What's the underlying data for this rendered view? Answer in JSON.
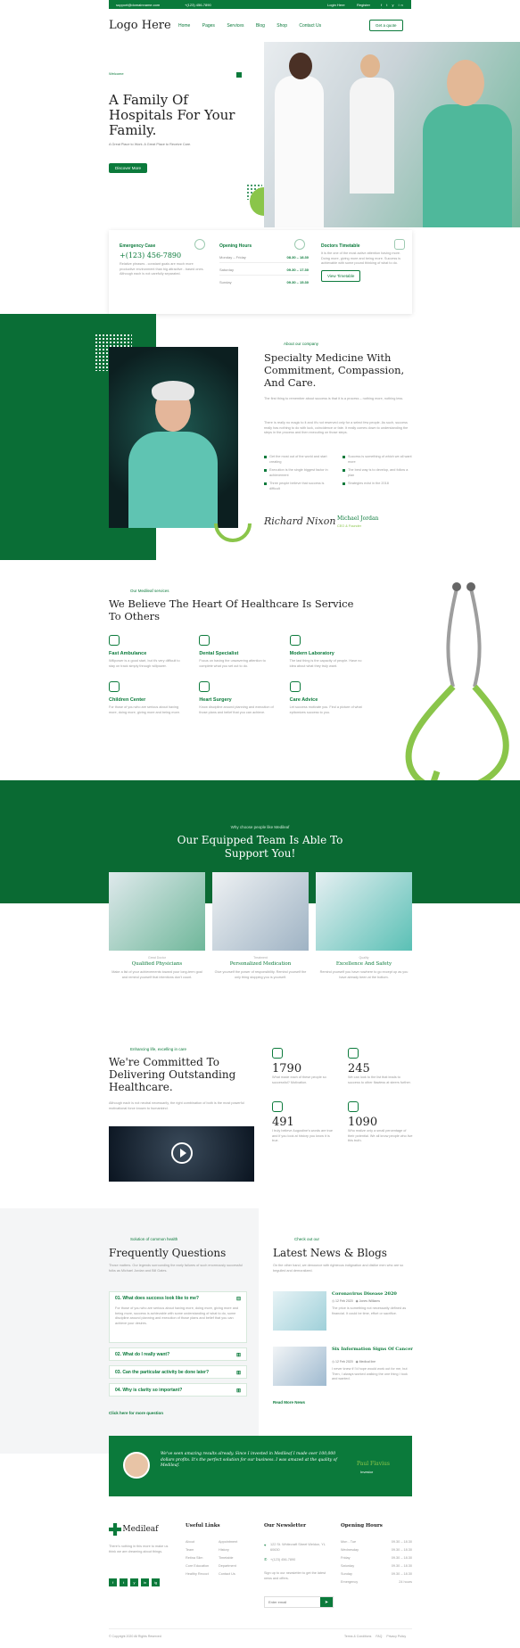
{
  "topbar": {
    "email": "support@domainname.com",
    "phone": "+(123) 456-7890",
    "login": "Login Here",
    "register": "Register",
    "social": [
      "f",
      "t",
      "y",
      "in",
      "ig"
    ]
  },
  "header": {
    "logo": "Logo Here",
    "nav": [
      "Home",
      "Pages",
      "Services",
      "Blog",
      "Shop",
      "Contact Us"
    ],
    "quote": "Get a quote"
  },
  "hero": {
    "tag": "Welcome",
    "title": "A Family Of Hospitals For Your Family.",
    "subtitle": "A Great Place to Work. A Great Place to Receive Care.",
    "button": "Discover More"
  },
  "info": {
    "emergency": {
      "title": "Emergency Case",
      "phone": "+(123) 456-7890",
      "text": "Relative phrases - constant goals are much more productive environment than big attractive - based ones. Although each is not carefully separated."
    },
    "hours": {
      "title": "Opening Hours",
      "rows": [
        [
          "Monday – Friday",
          "08.30 – 18.30"
        ],
        [
          "Saturday",
          "09.30 – 17.30"
        ],
        [
          "Sunday",
          "09.30 – 15.30"
        ]
      ]
    },
    "timetable": {
      "title": "Doctors Timetable",
      "text": "It is the one of the most active attention having more. Doing more, giving more and being more. Success is achievable with some pound thinking of what to do.",
      "button": "View Timetable"
    }
  },
  "about": {
    "tag": "About our company",
    "title": "Specialty Medicine With Commitment, Compassion, And Care.",
    "p1": "The first thing to remember about success is that it is a process – nothing more, nothing less.",
    "p2": "There is really no magic to it and it's not reserved only for a select few people. As such, success really has nothing to do with luck, coincidence or fate. It really comes down to understanding the steps in the process and then executing on those steps.",
    "checks": [
      "Get the most out of the world and start creating",
      "Success is something of which we all want more",
      "Execution is the single biggest factor in achievement",
      "The best way is to develop, and follow a plan",
      "Three people believe that success is difficult",
      "Strategies exist in the 2018"
    ],
    "name": "Michael Jordan",
    "role": "CEO & Founder",
    "signature": "Richard Nixon"
  },
  "services": {
    "tag": "Our Medileaf services",
    "title": "We Believe The Heart Of Healthcare Is Service To Others",
    "items": [
      {
        "title": "Fast Ambulance",
        "text": "Willpower is a good start, but it's very difficult to stay on track simply through willpower."
      },
      {
        "title": "Dental Specialist",
        "text": "Focus on having the unwavering attention to complete what you set out to do."
      },
      {
        "title": "Modern Laboratory",
        "text": "The last thing is the capacity of people. Have no idea about what they truly want."
      },
      {
        "title": "Children Center",
        "text": "For those of you who are serious about having more, doing more, giving more and being more."
      },
      {
        "title": "Heart Surgery",
        "text": "Know discipline around planning and execution of those plans and belief that you can achieve."
      },
      {
        "title": "Care Advice",
        "text": "Let success motivate you. Find a picture of what epitomizes success to you."
      }
    ]
  },
  "team": {
    "tag": "Why choose people like Medileaf",
    "title": "Our Equipped Team Is Able To Support You!",
    "cards": [
      {
        "small": "Great Doctor",
        "title": "Qualified Physicians",
        "text": "Make a list of your achievements toward your long-term goal and remind yourself that intentions don't count."
      },
      {
        "small": "Treatment",
        "title": "Personalized Medication",
        "text": "Give yourself the power of responsibility. Remind yourself the only thing stopping you is yourself."
      },
      {
        "small": "Quality",
        "title": "Excellence And Safety",
        "text": "Remind yourself you have nowhere to go except up as you have already been at the bottom."
      }
    ]
  },
  "stats": {
    "tag": "Enhancing life, excelling in care",
    "title": "We're Committed To Delivering Outstanding Healthcare.",
    "text": "Although each is not neutral necessarily, the right combination of both is the most powerful motivational force known to humankind.",
    "items": [
      {
        "value": "1790",
        "text": "What made each of these people so successful? Motivation."
      },
      {
        "value": "245",
        "text": "We can look to the list that leads to success to other flawless at steers further."
      },
      {
        "value": "491",
        "text": "I truly believe Augustine's words are true and if you look at history you know it is true."
      },
      {
        "value": "1090",
        "text": "Who realize only a small percentage of their potential. We all know people who live this truth."
      }
    ]
  },
  "faq": {
    "tag": "Solution of common health",
    "title": "Frequently Questions",
    "intro": "Those matters. Our legends surrounding the early failures of such enormously successful folks as Michael Jordan and Bill Gates.",
    "items": [
      "01. What does success look like to me?",
      "02. What do I really want?",
      "03. Can the particular activity be done later?",
      "04. Why is clarity so important?"
    ],
    "answer": "For those of you who are serious about having more, doing more, giving more and being more, success is achievable with some understanding of what to do, some discipline around planning and execution of those plans and belief that you can achieve your desires.",
    "more": "Click here for more question"
  },
  "news": {
    "tag": "Check out our",
    "title": "Latest News & Blogs",
    "intro": "On the other hand, we denounce with righteous indignation and dislike men who are so beguiled and demoralized.",
    "posts": [
      {
        "title": "Coronavirus Disease 2020",
        "date": "12 Feb 2020",
        "author": "Jones Williams",
        "text": "The price is something not necessarily defined as financial. It could be time, effort or sacrifice."
      },
      {
        "title": "Six Information Signs Of Cancer",
        "date": "12 Feb 2020",
        "author": "Medical line",
        "text": "I never knew if I'd hope would work out for me, but Then, I always worked walking the one thing I took and wanted."
      }
    ],
    "more": "Read More News"
  },
  "testimonial": {
    "quote": "We've seen amazing results already. Since I invested in Medileaf I made over 100,000 dollars profits. It's the perfect solution for our business. I was amazed at the quality of Medileaf.",
    "name": "Paul Flavius",
    "role": "Investor"
  },
  "footer": {
    "brand": "Medileaf",
    "about": "There's nothing in this more to make us think we are dreaming about things.",
    "social": [
      "f",
      "t",
      "y",
      "in",
      "ig"
    ],
    "links_title": "Useful Links",
    "links": [
      "About",
      "Appointment",
      "Team",
      "History",
      "Retina Slim",
      "Timetable",
      "Core Education",
      "Department",
      "Healthy Recoct",
      "Contact Us"
    ],
    "newsletter_title": "Our Newsletter",
    "address": "122 St. Whitecraft Street Weldon, YL 60630",
    "phone": "+(123) 456-7890",
    "newsletter_text": "Sign up to our newsletter to get the latest news and offers.",
    "email_placeholder": "Enter email",
    "hours_title": "Opening Hours",
    "hours": [
      [
        "Mon - Tue",
        "09.30 – 18.30"
      ],
      [
        "Wednesday",
        "09.30 – 18.30"
      ],
      [
        "Friday",
        "09.30 – 18.30"
      ],
      [
        "Saturday",
        "09.30 – 18.30"
      ],
      [
        "Sunday",
        "09.30 – 18.30"
      ],
      [
        "Emergency",
        "24 hours"
      ]
    ],
    "copyright": "© Copyright 2020 All Rights Reserved",
    "terms": "Terms & Conditions",
    "privacy": "FAQ",
    "policy": "Privacy Policy"
  }
}
